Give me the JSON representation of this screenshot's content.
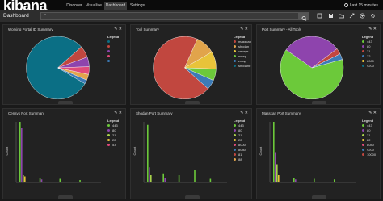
{
  "nav": {
    "logo": "kibana",
    "tabs": [
      "Discover",
      "Visualize",
      "Dashboard",
      "Settings"
    ],
    "time_range": "Last 15 minutes"
  },
  "dashboard": {
    "title": "Dashboard",
    "query": "*"
  },
  "panels": [
    {
      "title": "Working Portal ID Summary",
      "legend_title": "Legend",
      "legend": [
        "",
        "",
        "",
        "",
        ""
      ]
    },
    {
      "title": "Tool Summary",
      "legend_title": "Legend",
      "legend": [
        "masscan",
        "shodan",
        "censys",
        "nmap",
        "zmap",
        "shodanb"
      ]
    },
    {
      "title": "Port Summary - All Tools",
      "legend_title": "Legend",
      "legend": [
        "443",
        "80",
        "21",
        "22",
        "8080",
        "9200"
      ]
    },
    {
      "title": "Censys Port Summary",
      "legend_title": "Legend",
      "legend": [
        "443",
        "80",
        "21",
        "22",
        "53"
      ],
      "ylabel": "Count"
    },
    {
      "title": "Shodan Port Summary",
      "legend_title": "Legend",
      "legend": [
        "443",
        "80",
        "21",
        "22",
        "8000",
        "8080",
        "81",
        "88"
      ],
      "ylabel": "Count"
    },
    {
      "title": "Masscan Port Summary",
      "legend_title": "Legend",
      "legend": [
        "443",
        "80",
        "21",
        "22",
        "8080",
        "9200",
        "10000"
      ],
      "ylabel": "Count"
    }
  ],
  "colors": {
    "teal": "#0b6f85",
    "red": "#c1473f",
    "purple": "#8e44ad",
    "green": "#6cc93a",
    "orange": "#e1a44b",
    "yellow": "#e8c33a",
    "blue": "#3c7bb6",
    "pink": "#e04a7a",
    "lime": "#a8d24b"
  },
  "chart_data": [
    {
      "type": "pie",
      "values": [
        80,
        6,
        5,
        4,
        3,
        2
      ],
      "colors": [
        "#0b6f85",
        "#c1473f",
        "#8e44ad",
        "#e04a7a",
        "#e1a44b",
        "#3c7bb6"
      ]
    },
    {
      "type": "pie",
      "values": [
        70,
        10,
        9,
        6,
        5
      ],
      "colors": [
        "#c1473f",
        "#e1a44b",
        "#e8c33a",
        "#6cc93a",
        "#3c7bb6"
      ]
    },
    {
      "type": "pie",
      "values": [
        64,
        30,
        3,
        3
      ],
      "colors": [
        "#6cc93a",
        "#8e44ad",
        "#c1473f",
        "#3c7bb6"
      ]
    },
    {
      "type": "bar",
      "groups": [
        [
          100,
          90,
          12,
          10
        ],
        [
          8,
          5
        ],
        [
          6
        ],
        [
          4
        ]
      ],
      "colors": [
        "#6cc93a",
        "#8e44ad",
        "#a8d24b",
        "#e8c33a"
      ]
    },
    {
      "type": "bar",
      "groups": [
        [
          95,
          25,
          12
        ],
        [
          15,
          8
        ],
        [
          12
        ],
        [
          20
        ],
        [
          6
        ]
      ],
      "colors": [
        "#6cc93a",
        "#8e44ad",
        "#a8d24b",
        "#e8c33a"
      ]
    },
    {
      "type": "bar",
      "groups": [
        [
          100,
          50,
          30,
          12
        ],
        [
          8,
          5
        ],
        [
          6
        ],
        [
          5
        ]
      ],
      "colors": [
        "#6cc93a",
        "#8e44ad",
        "#a8d24b",
        "#e8c33a"
      ]
    }
  ]
}
